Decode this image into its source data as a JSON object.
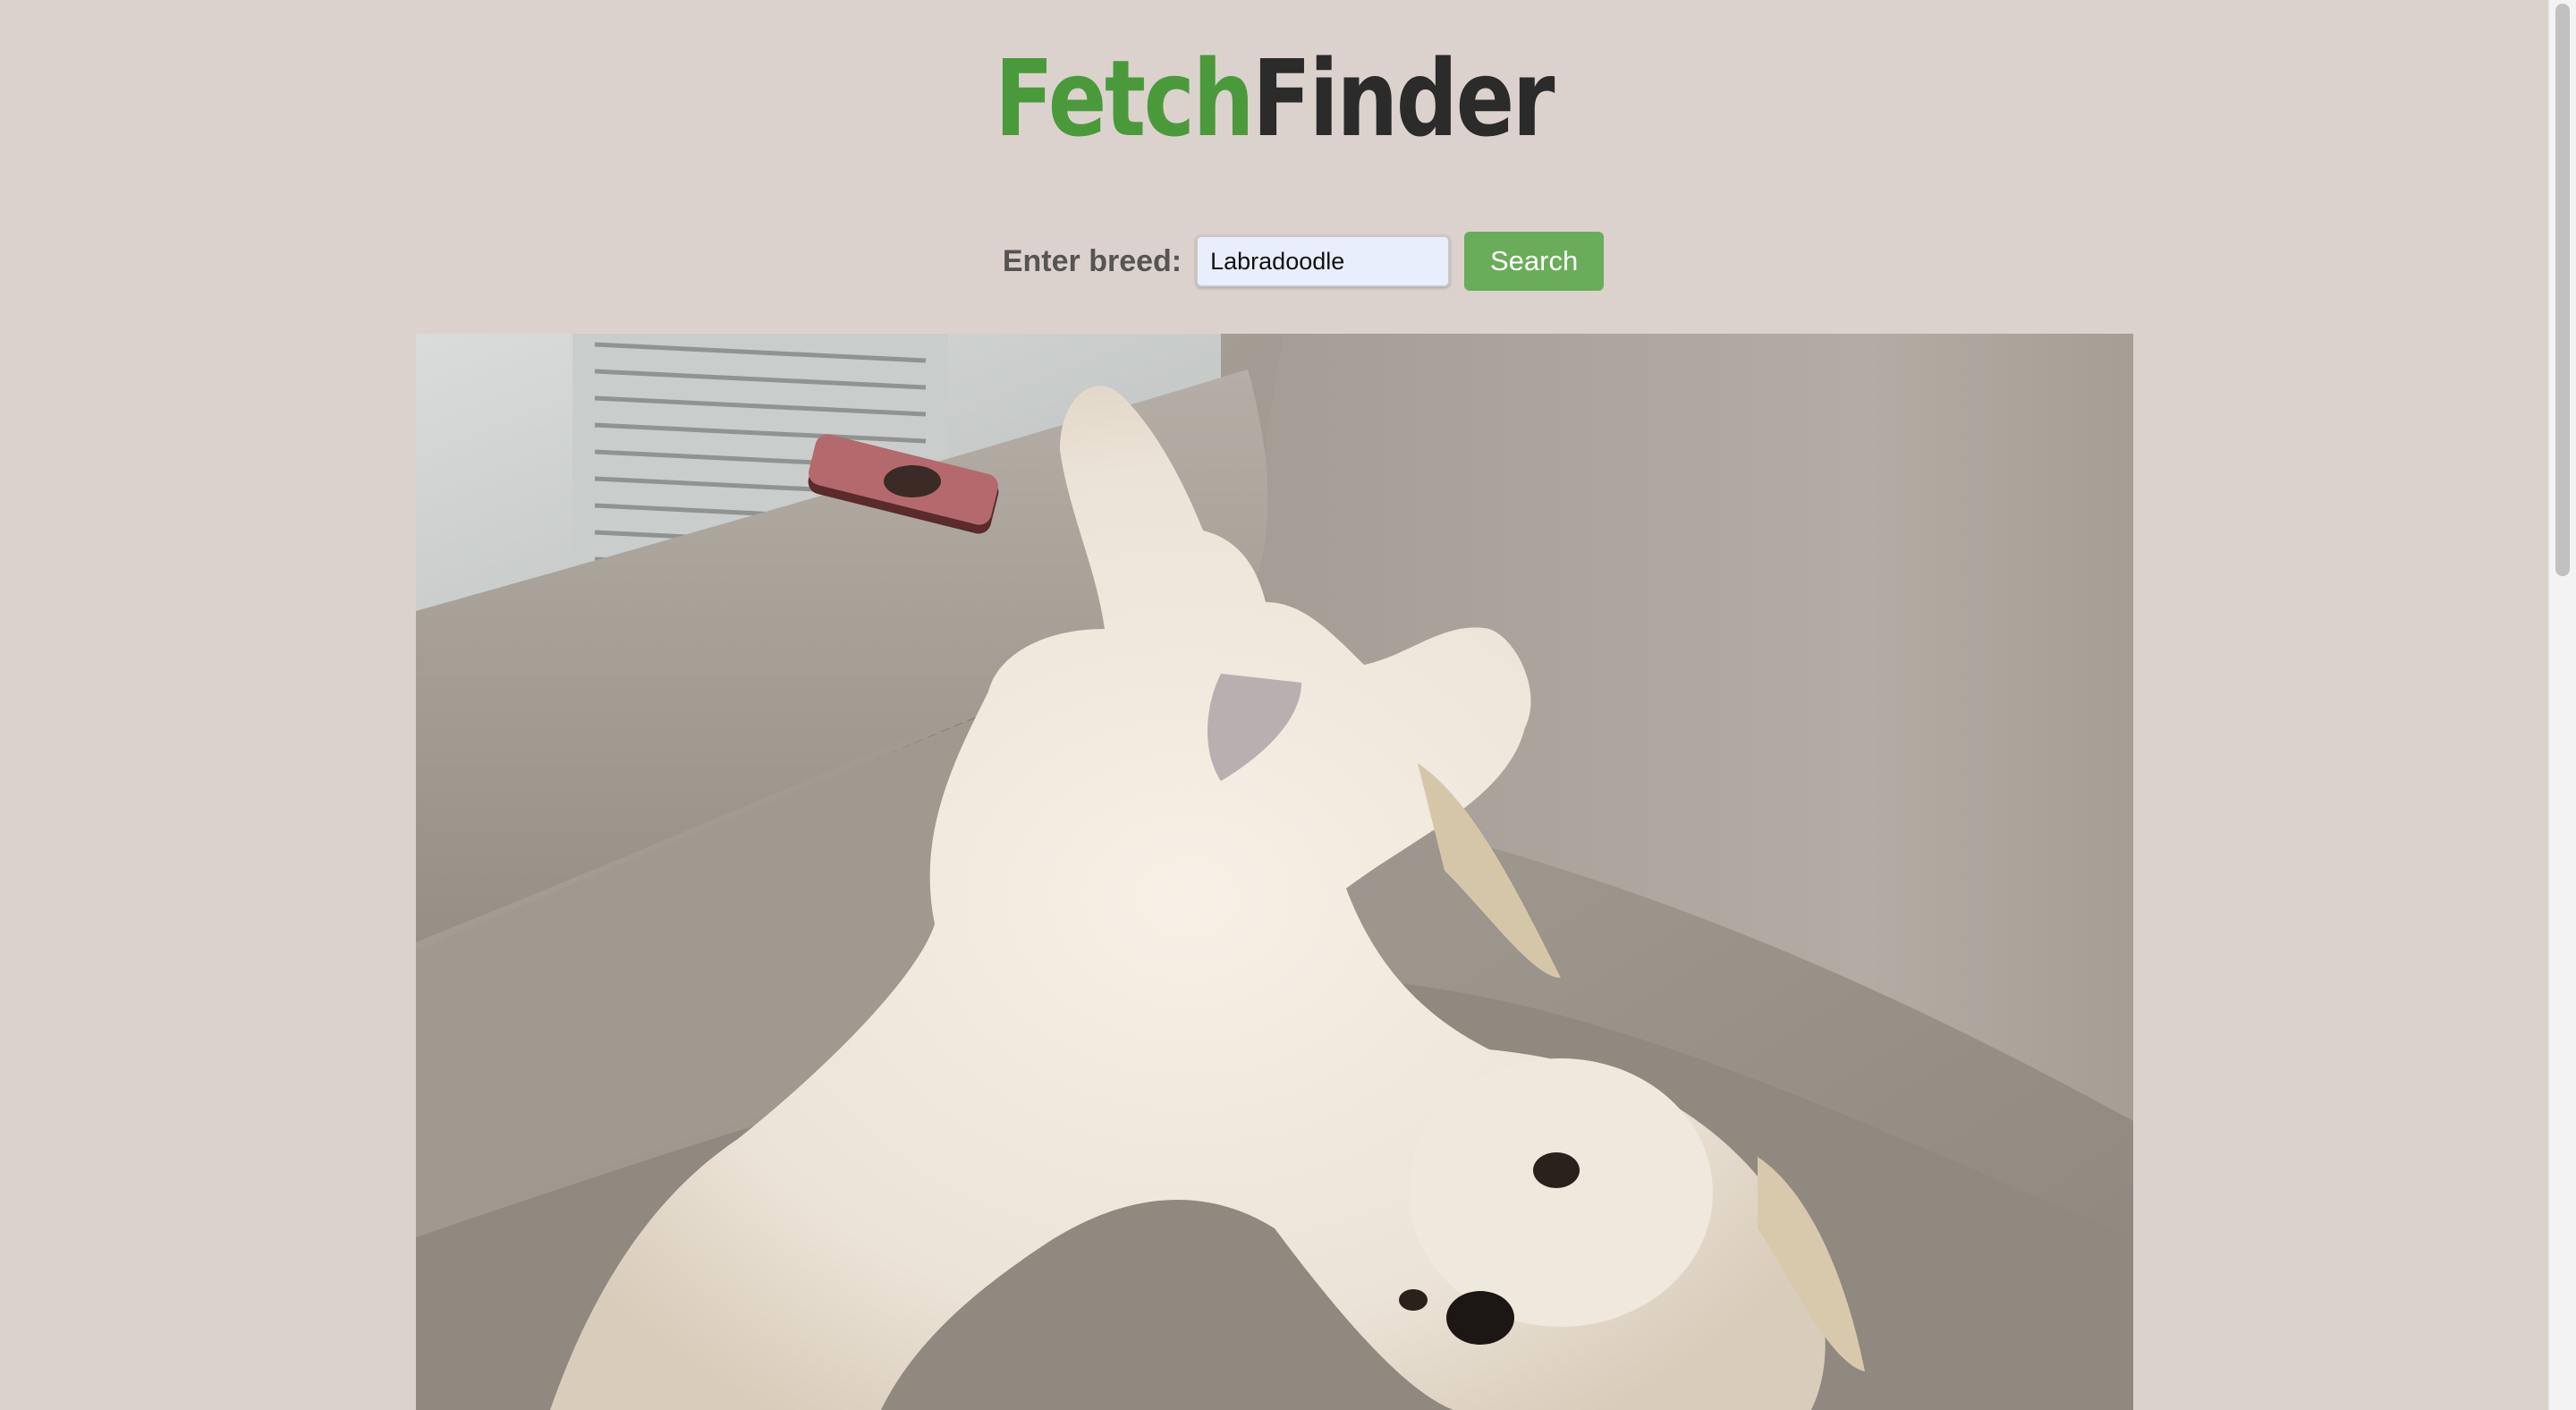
{
  "logo": {
    "part1": "Fetch",
    "part2": "Finder",
    "colors": {
      "part1": "#4a9a3c",
      "part2": "#2b2b2b"
    }
  },
  "search": {
    "label": "Enter breed:",
    "value": "Labradoodle",
    "button_label": "Search",
    "button_color": "#69ad5a"
  },
  "result": {
    "image_alt": "Dog photo",
    "subject": "white fluffy dog lying on its back on a taupe leather sofa"
  },
  "colors": {
    "page_background": "#dcd2cd"
  }
}
